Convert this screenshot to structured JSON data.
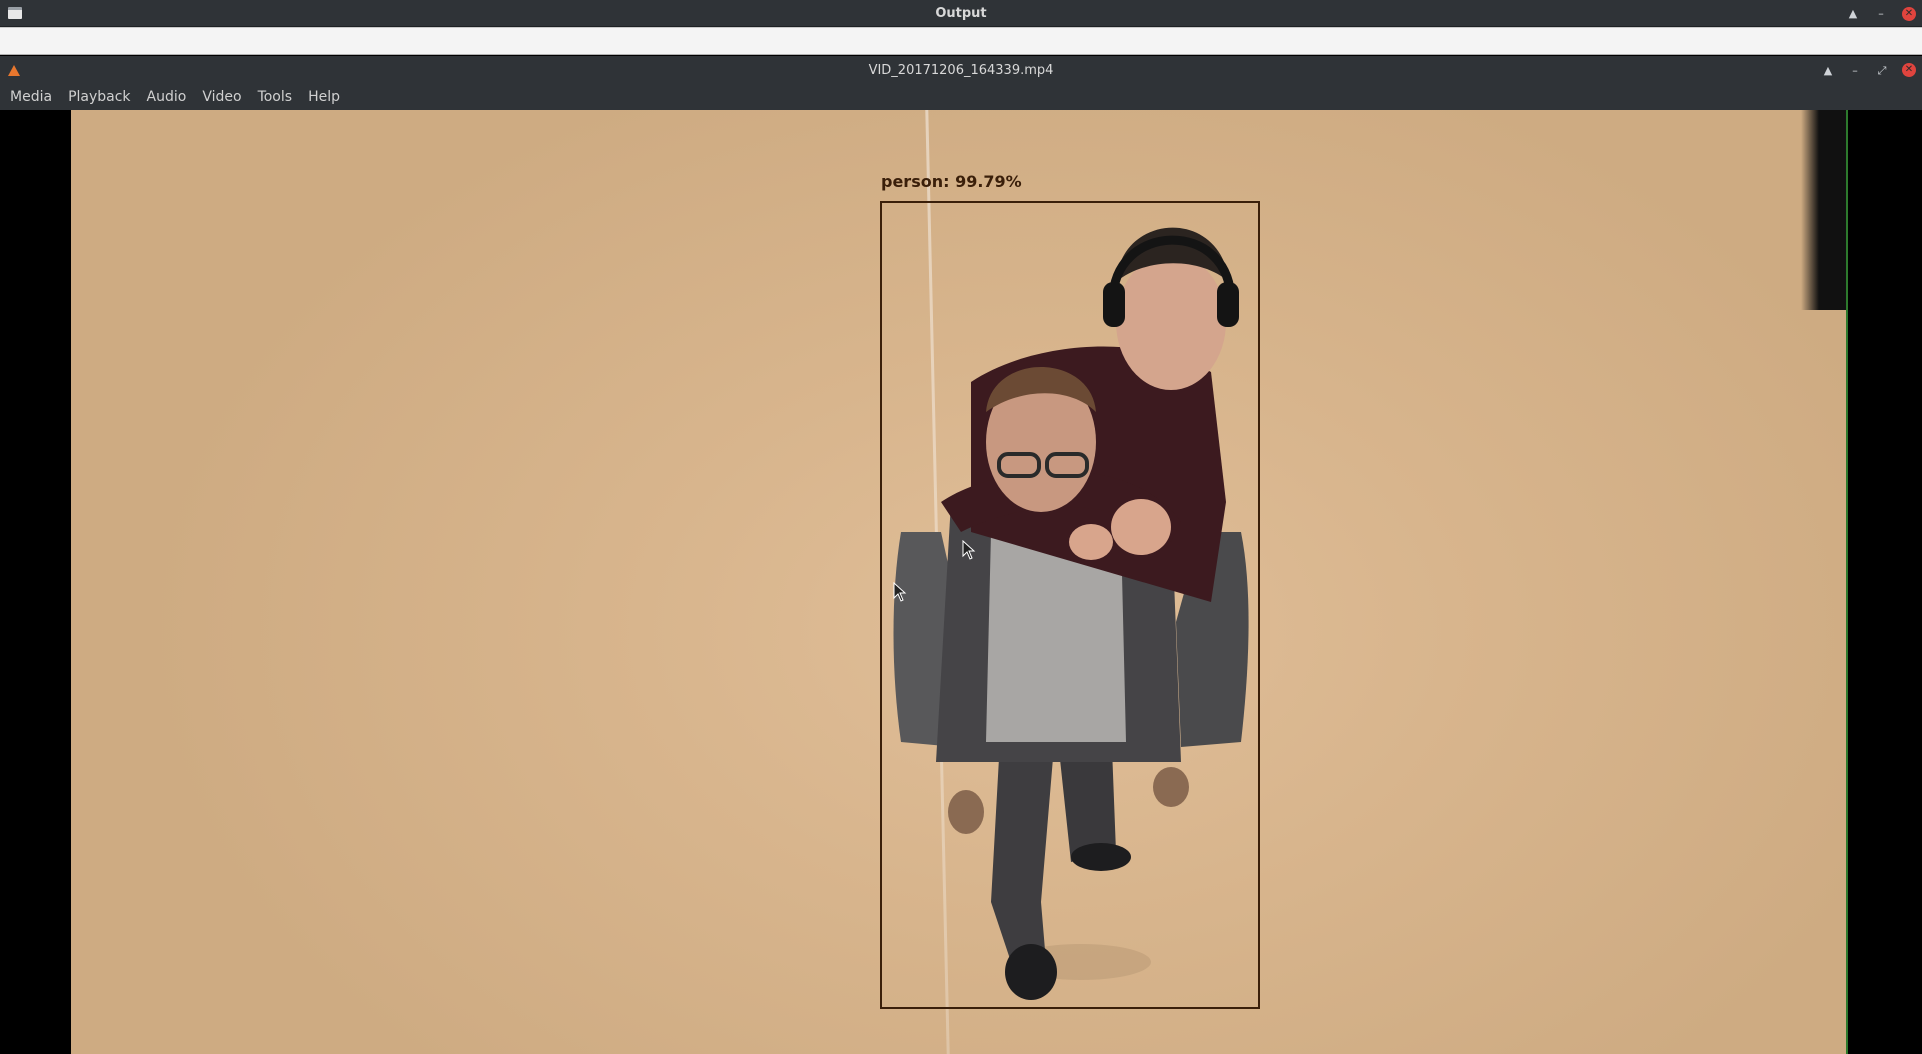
{
  "outer_window": {
    "title": "Output"
  },
  "player": {
    "title": "VID_20171206_164339.mp4",
    "menu": [
      "Media",
      "Playback",
      "Audio",
      "Video",
      "Tools",
      "Help"
    ]
  },
  "detection": {
    "label": "person: 99.79%",
    "box_color": "#3a1f0a"
  },
  "icons": {
    "outer_controls": [
      "maximize-icon",
      "minimize-icon",
      "close-icon"
    ],
    "inner_controls": [
      "eject-icon",
      "minimize-icon",
      "restore-icon",
      "close-icon"
    ]
  },
  "colors": {
    "chrome": "#2f3337",
    "close": "#e0443e",
    "floor": "#d8b58d"
  }
}
